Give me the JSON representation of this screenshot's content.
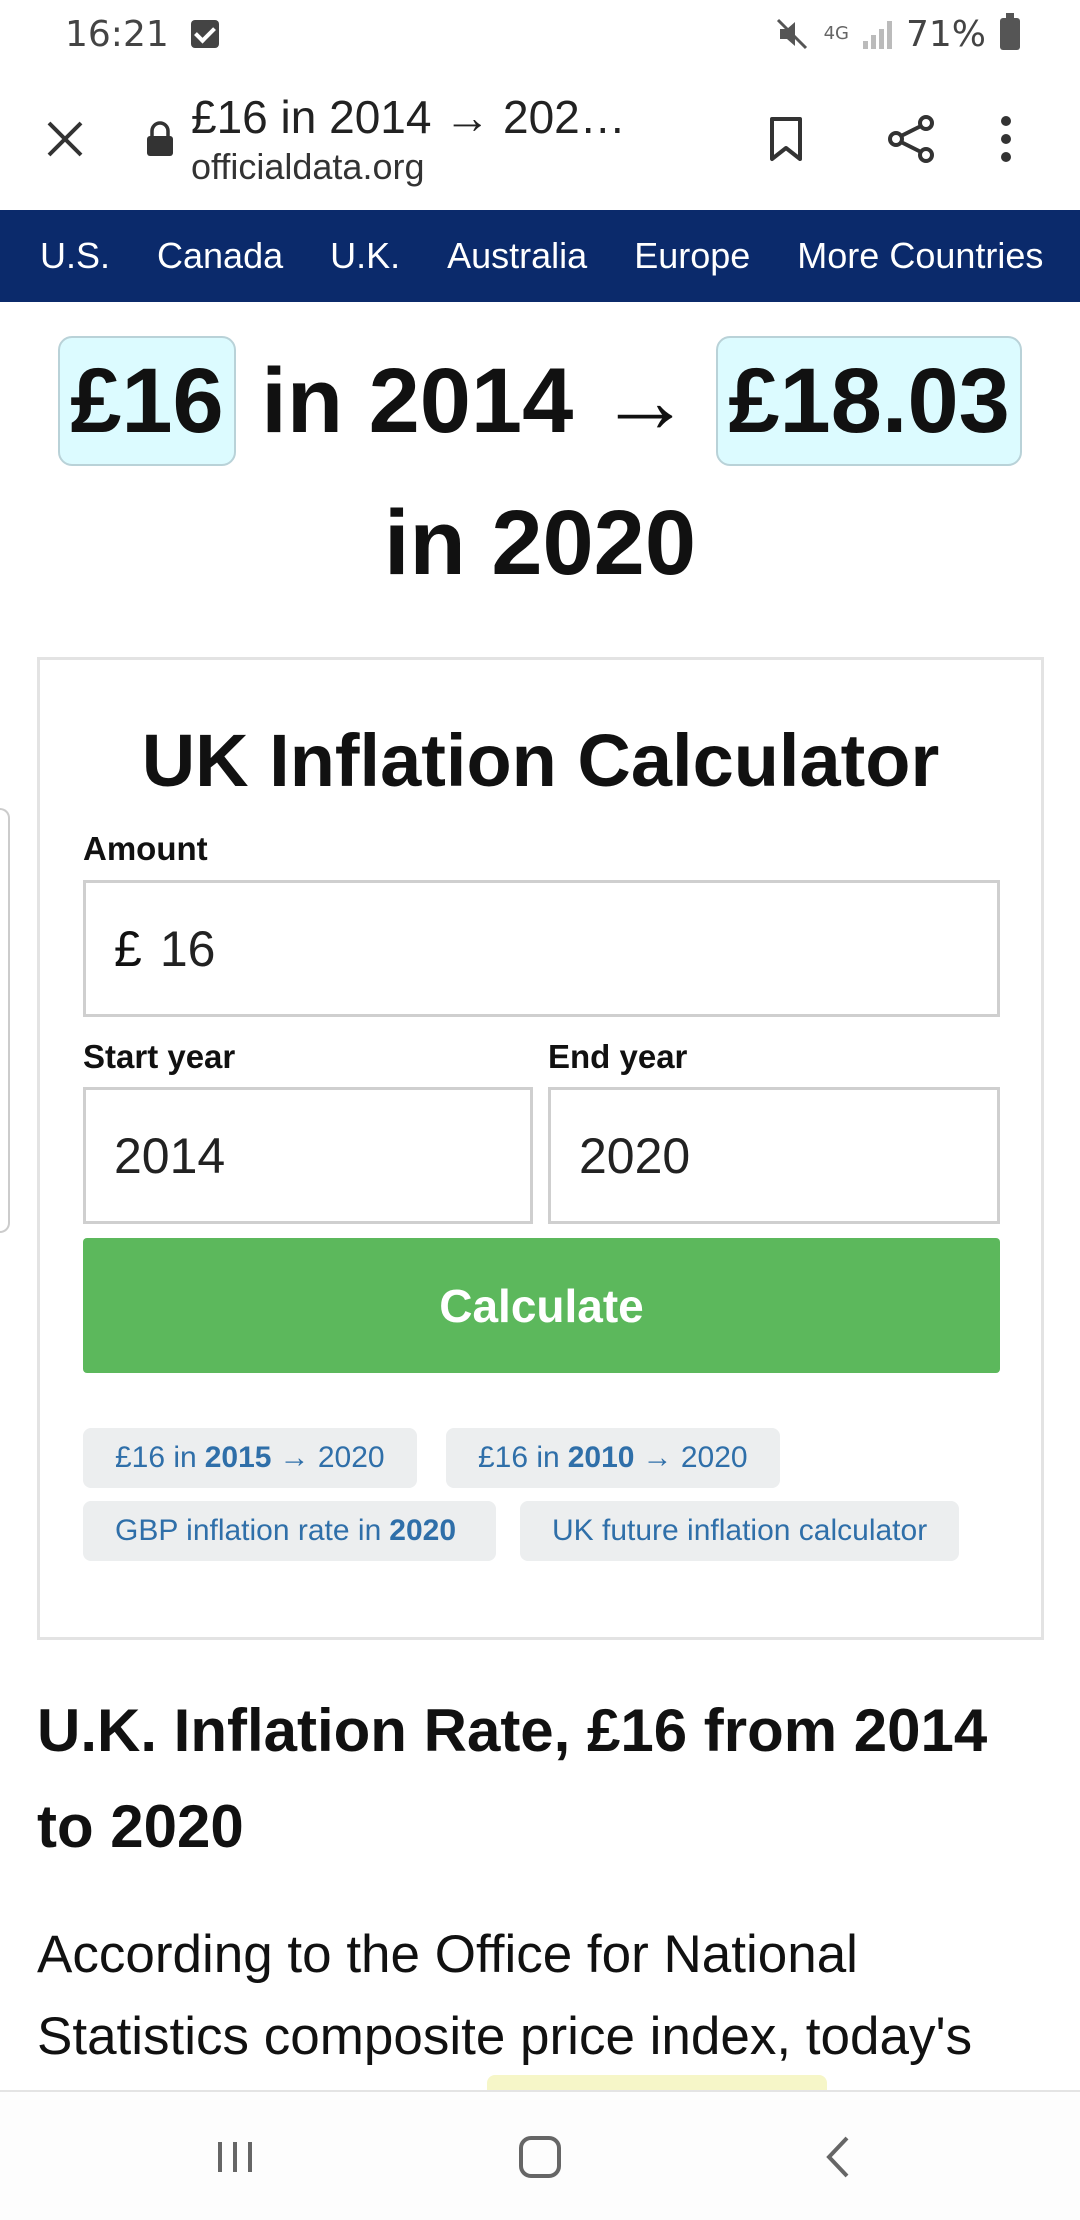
{
  "status_bar": {
    "time": "16:21",
    "network": "4G",
    "battery": "71%"
  },
  "browser": {
    "page_title": "£16 in 2014 → 202…",
    "domain": "officialdata.org"
  },
  "nav": {
    "items": [
      "U.S.",
      "Canada",
      "U.K.",
      "Australia",
      "Europe",
      "More Countries"
    ]
  },
  "headline": {
    "amount": "£16",
    "in_label": "in",
    "start_year": "2014",
    "arrow": "→",
    "result": "£18.03",
    "end_label": "in 2020"
  },
  "calculator": {
    "title": "UK Inflation Calculator",
    "amount_label": "Amount",
    "currency_symbol": "£",
    "amount_value": "16",
    "start_label": "Start year",
    "start_value": "2014",
    "end_label": "End year",
    "end_value": "2020",
    "button_label": "Calculate",
    "links": [
      {
        "prefix": "£16 in",
        "bold": "2015",
        "suffix": "→ 2020"
      },
      {
        "prefix": "£16 in",
        "bold": "2010",
        "suffix": "→ 2020"
      },
      {
        "prefix": "GBP inflation rate in",
        "bold": "2020",
        "suffix": ""
      },
      {
        "prefix": "UK future inflation calculator",
        "bold": "",
        "suffix": ""
      }
    ]
  },
  "article": {
    "heading": "U.K. Inflation Rate, £16 from 2014 to 2020",
    "paragraph": "According to the Office for National Statistics composite price index, today's"
  },
  "colors": {
    "nav_bg": "#0b2a6b",
    "button_green": "#5cb85c",
    "pill_bg": "#dcfbff",
    "link_blue": "#2f6fa9"
  }
}
